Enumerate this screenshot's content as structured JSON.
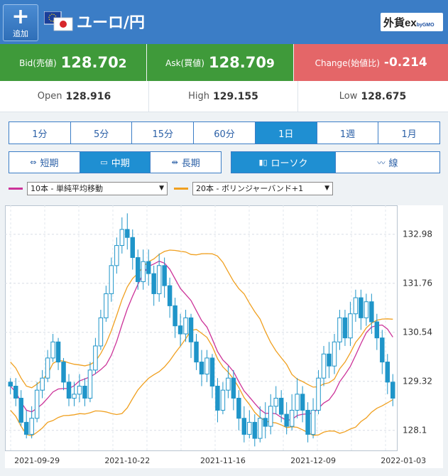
{
  "header": {
    "add_label": "追加",
    "title": "ユーロ/円",
    "brand_main": "外貨ex",
    "brand_sub": "byGMO"
  },
  "prices": {
    "bid_label": "Bid(売値)",
    "bid_main": "128.70",
    "bid_tail": "2",
    "ask_label": "Ask(買値)",
    "ask_main": "128.70",
    "ask_tail": "9",
    "change_label": "Change(始値比)",
    "change_value": "-0.214"
  },
  "ohl": {
    "open_label": "Open",
    "open_main": "128.91",
    "open_tail": "6",
    "high_label": "High",
    "high_main": "129.15",
    "high_tail": "5",
    "low_label": "Low",
    "low_main": "128.67",
    "low_tail": "5"
  },
  "timeframes": [
    "1分",
    "5分",
    "15分",
    "60分",
    "1日",
    "1週",
    "1月"
  ],
  "active_timeframe": "1日",
  "ranges": [
    "短期",
    "中期",
    "長期"
  ],
  "active_range": "中期",
  "chart_types": [
    "ローソク",
    "線"
  ],
  "active_chart_type": "ローソク",
  "indicators": {
    "ma_label": "10本 - 単純平均移動",
    "ma_color": "#cc3399",
    "bb_label": "20本 - ボリンジャーバンド+1",
    "bb_color": "#f0a020"
  },
  "colors": {
    "header": "#3b7dc6",
    "bid_bg": "#3f9a3a",
    "change_bg": "#e46668",
    "candle": "#1f95c9",
    "active_tab": "#1f8fd2"
  },
  "chart_data": {
    "type": "candlestick",
    "ylim": [
      127.6,
      133.7
    ],
    "y_ticks": [
      "132.98",
      "131.76",
      "130.54",
      "129.32",
      "128.1"
    ],
    "y_tick_values": [
      132.98,
      131.76,
      130.54,
      129.32,
      128.1
    ],
    "x_tick_labels": [
      "2021-09-29",
      "2021-10-22",
      "2021-11-16",
      "2021-12-09",
      "2022-01-03"
    ],
    "x_tick_index": [
      5,
      22,
      40,
      57,
      74
    ],
    "grid": true,
    "candles": [
      [
        129.3,
        129.2,
        129.4,
        129.0
      ],
      [
        129.2,
        128.9,
        129.4,
        128.7
      ],
      [
        128.9,
        128.3,
        129.1,
        128.2
      ],
      [
        128.3,
        128.0,
        128.6,
        127.9
      ],
      [
        128.0,
        128.4,
        128.7,
        127.9
      ],
      [
        128.4,
        129.1,
        129.3,
        128.3
      ],
      [
        129.1,
        129.4,
        129.6,
        128.9
      ],
      [
        129.4,
        129.9,
        130.1,
        129.3
      ],
      [
        129.9,
        130.3,
        130.5,
        129.8
      ],
      [
        130.3,
        129.8,
        130.4,
        129.6
      ],
      [
        129.8,
        129.3,
        129.9,
        129.1
      ],
      [
        129.3,
        128.9,
        129.5,
        128.7
      ],
      [
        128.9,
        129.0,
        129.3,
        128.7
      ],
      [
        129.0,
        129.2,
        129.5,
        128.8
      ],
      [
        129.2,
        128.9,
        129.4,
        128.7
      ],
      [
        128.9,
        129.6,
        129.8,
        128.8
      ],
      [
        129.6,
        130.2,
        130.4,
        129.5
      ],
      [
        130.2,
        130.9,
        131.1,
        130.1
      ],
      [
        130.9,
        131.5,
        131.7,
        130.8
      ],
      [
        131.5,
        132.2,
        132.4,
        131.3
      ],
      [
        132.2,
        132.7,
        132.9,
        132.0
      ],
      [
        132.7,
        133.1,
        133.4,
        132.5
      ],
      [
        133.1,
        132.9,
        133.5,
        132.6
      ],
      [
        132.9,
        132.4,
        133.1,
        132.1
      ],
      [
        132.4,
        131.8,
        132.6,
        131.6
      ],
      [
        131.8,
        132.3,
        132.6,
        131.6
      ],
      [
        132.3,
        132.0,
        132.6,
        131.7
      ],
      [
        132.0,
        131.5,
        132.2,
        131.2
      ],
      [
        131.5,
        132.2,
        132.5,
        131.3
      ],
      [
        132.2,
        131.7,
        132.4,
        131.4
      ],
      [
        131.7,
        131.2,
        131.9,
        130.9
      ],
      [
        131.2,
        130.7,
        131.4,
        130.4
      ],
      [
        130.7,
        130.5,
        131.0,
        130.2
      ],
      [
        130.5,
        130.9,
        131.1,
        130.3
      ],
      [
        130.9,
        130.3,
        131.0,
        129.9
      ],
      [
        130.3,
        129.8,
        130.5,
        129.6
      ],
      [
        129.8,
        129.5,
        130.1,
        129.2
      ],
      [
        129.5,
        129.9,
        130.1,
        129.3
      ],
      [
        129.9,
        129.2,
        130.0,
        128.9
      ],
      [
        129.2,
        128.6,
        129.4,
        128.3
      ],
      [
        128.6,
        129.1,
        129.3,
        128.5
      ],
      [
        129.1,
        129.4,
        129.7,
        128.9
      ],
      [
        129.4,
        128.9,
        129.6,
        128.6
      ],
      [
        128.9,
        128.4,
        129.1,
        128.1
      ],
      [
        128.4,
        128.0,
        128.7,
        127.8
      ],
      [
        128.0,
        128.3,
        128.6,
        127.9
      ],
      [
        128.3,
        127.9,
        128.5,
        127.7
      ],
      [
        127.9,
        128.4,
        128.7,
        127.8
      ],
      [
        128.4,
        128.2,
        128.8,
        127.9
      ],
      [
        128.2,
        128.7,
        129.0,
        128.0
      ],
      [
        128.7,
        128.9,
        129.2,
        128.5
      ],
      [
        128.9,
        128.5,
        129.1,
        128.3
      ],
      [
        128.5,
        128.2,
        128.8,
        128.0
      ],
      [
        128.2,
        128.6,
        129.0,
        128.1
      ],
      [
        128.6,
        129.0,
        129.4,
        128.4
      ],
      [
        129.0,
        128.6,
        129.2,
        128.3
      ],
      [
        128.6,
        128.0,
        128.8,
        127.8
      ],
      [
        128.0,
        128.6,
        128.9,
        127.9
      ],
      [
        128.6,
        129.4,
        129.6,
        128.5
      ],
      [
        129.4,
        130.0,
        130.2,
        129.2
      ],
      [
        130.0,
        129.7,
        130.3,
        129.4
      ],
      [
        129.7,
        130.3,
        130.5,
        129.5
      ],
      [
        130.3,
        130.9,
        131.1,
        130.1
      ],
      [
        130.9,
        130.4,
        131.1,
        130.2
      ],
      [
        130.4,
        131.0,
        131.3,
        130.2
      ],
      [
        131.0,
        131.4,
        131.6,
        130.8
      ],
      [
        131.4,
        130.9,
        131.6,
        130.6
      ],
      [
        130.9,
        131.3,
        131.5,
        130.7
      ],
      [
        131.3,
        130.8,
        131.5,
        130.5
      ],
      [
        130.8,
        130.4,
        131.0,
        130.1
      ],
      [
        130.4,
        129.8,
        130.6,
        129.5
      ],
      [
        129.8,
        129.3,
        130.0,
        129.0
      ],
      [
        129.3,
        128.9,
        129.5,
        128.7
      ]
    ]
  }
}
